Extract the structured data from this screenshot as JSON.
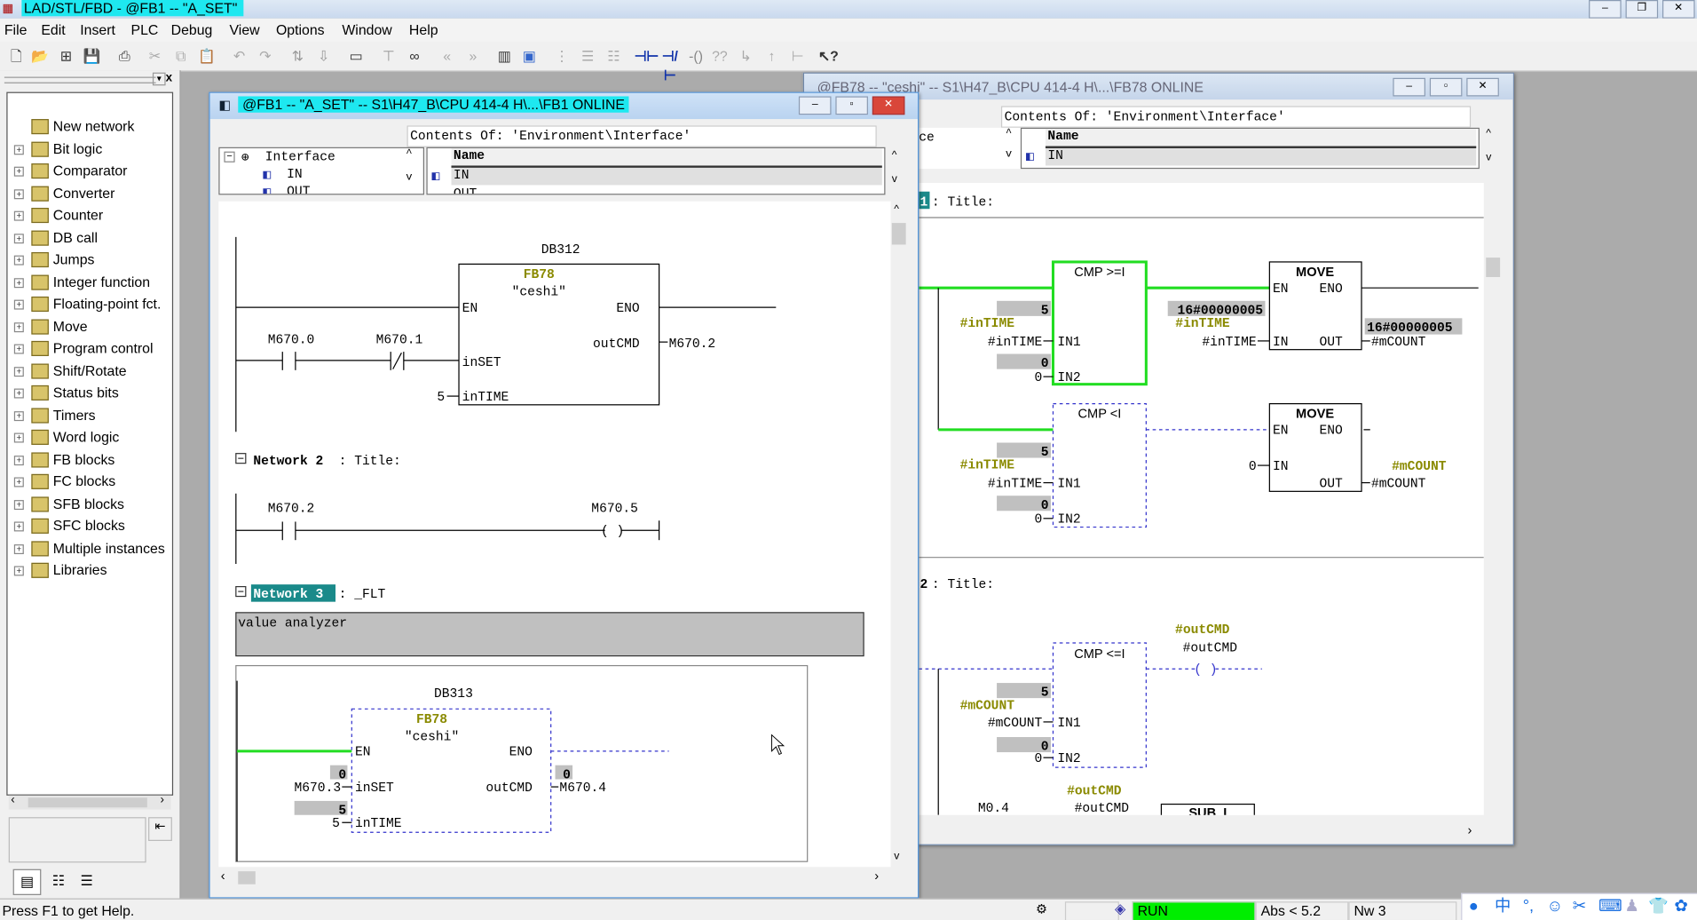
{
  "app": {
    "title": "LAD/STL/FBD  - @FB1 -- \"A_SET\"",
    "menu": [
      "File",
      "Edit",
      "Insert",
      "PLC",
      "Debug",
      "View",
      "Options",
      "Window",
      "Help"
    ],
    "accent": "#1ee8f0"
  },
  "sidebar": {
    "items": [
      {
        "label": "New network",
        "icon": "new-network-icon"
      },
      {
        "label": "Bit logic",
        "icon": "bit-logic-icon"
      },
      {
        "label": "Comparator",
        "icon": "comparator-icon"
      },
      {
        "label": "Converter",
        "icon": "converter-icon"
      },
      {
        "label": "Counter",
        "icon": "counter-icon"
      },
      {
        "label": "DB call",
        "icon": "db-call-icon"
      },
      {
        "label": "Jumps",
        "icon": "jumps-icon"
      },
      {
        "label": "Integer function",
        "icon": "integer-function-icon"
      },
      {
        "label": "Floating-point fct.",
        "icon": "floating-point-icon"
      },
      {
        "label": "Move",
        "icon": "move-icon"
      },
      {
        "label": "Program control",
        "icon": "program-control-icon"
      },
      {
        "label": "Shift/Rotate",
        "icon": "shift-rotate-icon"
      },
      {
        "label": "Status bits",
        "icon": "status-bits-icon"
      },
      {
        "label": "Timers",
        "icon": "timers-icon"
      },
      {
        "label": "Word logic",
        "icon": "word-logic-icon"
      },
      {
        "label": "FB blocks",
        "icon": "fb-blocks-icon"
      },
      {
        "label": "FC blocks",
        "icon": "fc-blocks-icon"
      },
      {
        "label": "SFB blocks",
        "icon": "sfb-blocks-icon"
      },
      {
        "label": "SFC blocks",
        "icon": "sfc-blocks-icon"
      },
      {
        "label": "Multiple instances",
        "icon": "multiple-instances-icon"
      },
      {
        "label": "Libraries",
        "icon": "libraries-icon"
      }
    ]
  },
  "win1": {
    "title": "@FB1 -- \"A_SET\" -- S1\\H47_B\\CPU 414-4 H\\...\\FB1  ONLINE",
    "contents_of": "Contents Of: 'Environment\\Interface'",
    "tree": [
      "Interface",
      "IN",
      "OUT"
    ],
    "table_header": "Name",
    "table_rows": [
      "IN",
      "OUT"
    ],
    "net1": {
      "db": "DB312",
      "fb": "FB78",
      "name": "\"ceshi\"",
      "en": "EN",
      "eno": "ENO",
      "in_set": "inSET",
      "in_time": "inTIME",
      "out_cmd": "outCMD",
      "contact1": "M670.0",
      "contact2": "M670.1",
      "out": "M670.2",
      "time_val": "5"
    },
    "net2": {
      "label": "Network 2",
      "title": ": Title:",
      "contact": "M670.2",
      "coil": "M670.5"
    },
    "net3": {
      "label": "Network 3",
      "title": ": _FLT",
      "comment": "value analyzer",
      "db": "DB313",
      "fb": "FB78",
      "name": "\"ceshi\"",
      "en": "EN",
      "eno": "ENO",
      "in_set": "inSET",
      "in_time": "inTIME",
      "out_cmd": "outCMD",
      "set_addr": "M670.3",
      "set_status": "0",
      "time_val": "5",
      "time_status": "5",
      "out_addr": "M670.4",
      "out_status": "0"
    }
  },
  "win2": {
    "title": "@FB78 -- \"ceshi\" -- S1\\H47_B\\CPU 414-4 H\\...\\FB78  ONLINE",
    "contents_of": "Contents Of: 'Environment\\Interface'",
    "tree_partial": "ce",
    "table_header": "Name",
    "table_row": "IN",
    "net1": {
      "number": "1",
      "title": ": Title:",
      "cmp1": {
        "label": "CMP >=I",
        "in1": "IN1",
        "in2": "IN2",
        "in1_status": "5",
        "in1_sym": "#inTIME",
        "in1_addr": "#inTIME",
        "in2_status": "0",
        "in2_addr": "0"
      },
      "move1": {
        "label": "MOVE",
        "en": "EN",
        "eno": "ENO",
        "in": "IN",
        "out": "OUT",
        "in_status": "16#00000005",
        "in_sym": "#inTIME",
        "in_addr": "#inTIME",
        "out_addr": "#mCOUNT",
        "out_status": "16#00000005"
      },
      "cmp2": {
        "label": "CMP <I",
        "in1": "IN1",
        "in2": "IN2",
        "in1_status": "5",
        "in1_sym": "#inTIME",
        "in1_addr": "#inTIME",
        "in2_status": "0",
        "in2_addr": "0"
      },
      "move2": {
        "label": "MOVE",
        "en": "EN",
        "eno": "ENO",
        "in": "IN",
        "out": "OUT",
        "in_addr": "0",
        "out_sym": "#mCOUNT",
        "out_addr": "#mCOUNT"
      }
    },
    "net2": {
      "number": "2",
      "title": ": Title:",
      "cmp": {
        "label": "CMP <=I",
        "in1": "IN1",
        "in2": "IN2",
        "in1_status": "5",
        "in1_sym": "#mCOUNT",
        "in1_addr": "#mCOUNT",
        "in2_status": "0",
        "in2_addr": "0"
      },
      "coil_sym": "#outCMD",
      "coil_addr": "#outCMD",
      "contact": "M0.4",
      "contact2_sym": "#outCMD",
      "contact2_addr": "#outCMD",
      "sub": "SUB_I"
    }
  },
  "status": {
    "help": "Press F1 to get Help.",
    "mode": "RUN",
    "mode_color": "#00ee00",
    "abs": "Abs < 5.2",
    "nw": "Nw 3"
  }
}
